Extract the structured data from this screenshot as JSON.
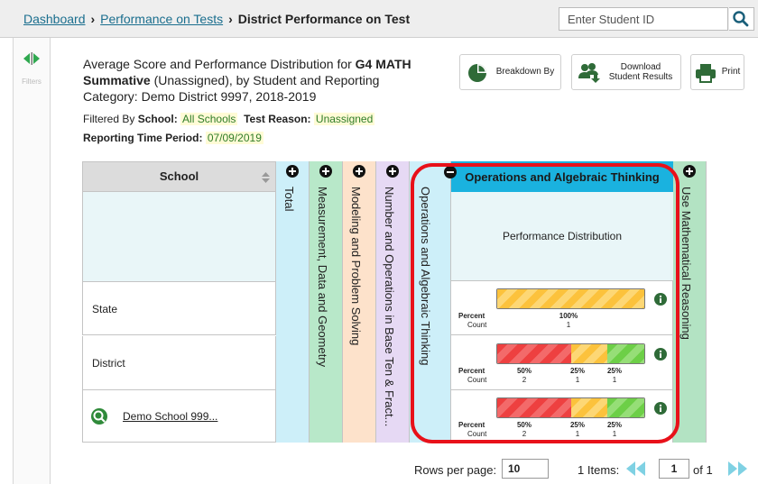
{
  "breadcrumb": {
    "home": "Dashboard",
    "level2": "Performance on Tests",
    "current": "District Performance on Test"
  },
  "search": {
    "placeholder": "Enter Student ID"
  },
  "sidebar": {
    "filters_label": "Filters"
  },
  "header": {
    "line1_pre": "Average Score and Performance Distribution for ",
    "line1_bold": "G4 MATH",
    "line2_bold": "Summative",
    "line2_rest": " (Unassigned), by Student and Reporting",
    "line3": "Category: Demo District 9997, 2018-2019",
    "filtered_by": "Filtered By",
    "school_label": "School:",
    "school_value": "All Schools",
    "reason_label": "Test Reason:",
    "reason_value": "Unassigned",
    "period_label": "Reporting Time Period:",
    "period_value": "07/09/2019"
  },
  "toolbar": {
    "breakdown": "Breakdown By",
    "download_line1": "Download",
    "download_line2": "Student Results",
    "print": "Print"
  },
  "table": {
    "school_header": "School",
    "rows": [
      "State",
      "District",
      "Demo School 999..."
    ],
    "collapsed_columns": [
      "Total",
      "Measurement, Data and Geometry",
      "Modeling and Problem Solving",
      "Number and Operations in Base Ten & Fract...",
      "Operations and Algebraic Thinking",
      "Use Mathematical Reasoning"
    ],
    "expanded_column": {
      "title": "Operations and Algebraic Thinking",
      "subheader": "Performance Distribution",
      "percent_label": "Percent",
      "count_label": "Count",
      "rows": [
        {
          "segments": [
            {
              "level": "y",
              "percent": 100,
              "percent_label": "100%",
              "count": "1"
            }
          ]
        },
        {
          "segments": [
            {
              "level": "r",
              "percent": 50,
              "percent_label": "50%",
              "count": "2"
            },
            {
              "level": "y",
              "percent": 25,
              "percent_label": "25%",
              "count": "1"
            },
            {
              "level": "g",
              "percent": 25,
              "percent_label": "25%",
              "count": "1"
            }
          ]
        },
        {
          "segments": [
            {
              "level": "r",
              "percent": 50,
              "percent_label": "50%",
              "count": "2"
            },
            {
              "level": "y",
              "percent": 25,
              "percent_label": "25%",
              "count": "1"
            },
            {
              "level": "g",
              "percent": 25,
              "percent_label": "25%",
              "count": "1"
            }
          ]
        }
      ]
    }
  },
  "pagination": {
    "rows_per_page_label": "Rows per page:",
    "rows_per_page": "10",
    "item_count": "1",
    "items_label": "Items:",
    "page": "1",
    "of_label": "of 1"
  },
  "colors": {
    "accent": "#1ab2df",
    "level_red": "#ee4040",
    "level_yellow": "#fcc23c",
    "level_green": "#6dcf47",
    "col_total": "#cdeff9",
    "col_measurement": "#b8e8c9",
    "col_modeling": "#fde2cb",
    "col_number": "#e6d9f4",
    "col_operations": "#cdeff9",
    "col_use": "#b3e3c3",
    "highlight_box": "#e8111a"
  }
}
